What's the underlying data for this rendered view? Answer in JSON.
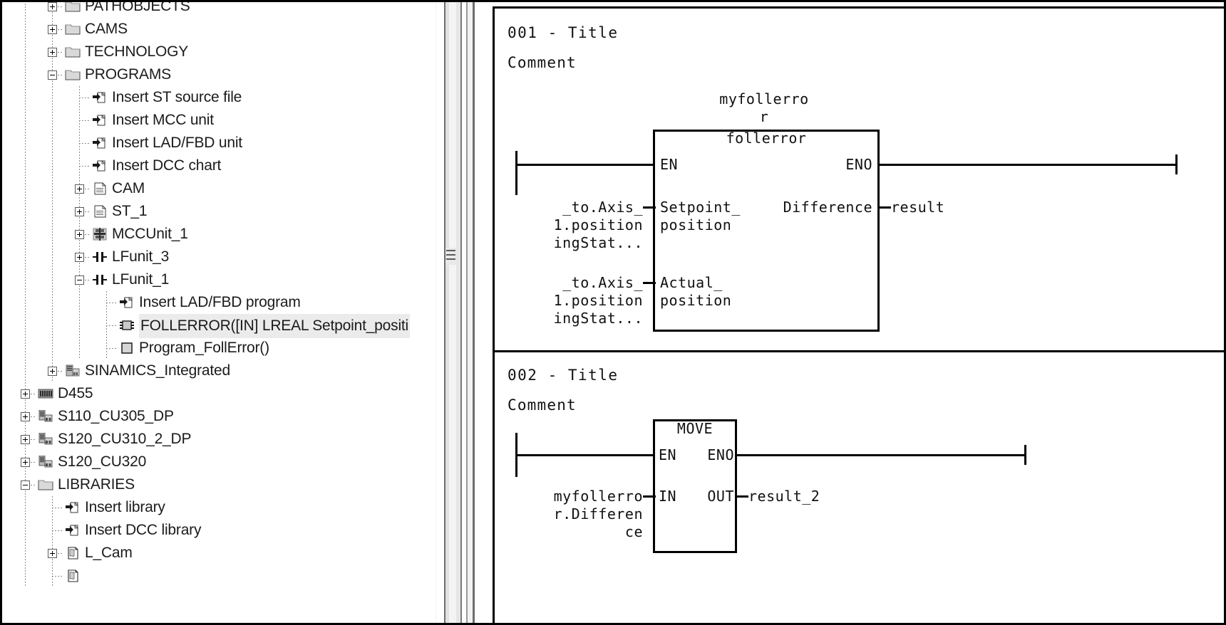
{
  "app": {
    "kind": "plc-engineering-fbd-editor"
  },
  "tree": {
    "name": "project-navigator",
    "items": [
      {
        "label": "PATHOBJECTS",
        "depth": 1,
        "expander": "plus",
        "icon": "folder-icon",
        "selected": false,
        "clipped_top": true
      },
      {
        "label": "CAMS",
        "depth": 1,
        "expander": "plus",
        "icon": "folder-icon",
        "selected": false
      },
      {
        "label": "TECHNOLOGY",
        "depth": 1,
        "expander": "plus",
        "icon": "folder-icon",
        "selected": false
      },
      {
        "label": "PROGRAMS",
        "depth": 1,
        "expander": "minus",
        "icon": "folder-icon",
        "selected": false
      },
      {
        "label": "Insert ST source file",
        "depth": 2,
        "expander": "none",
        "icon": "insert-arrow-icon",
        "selected": false
      },
      {
        "label": "Insert MCC unit",
        "depth": 2,
        "expander": "none",
        "icon": "insert-arrow-icon",
        "selected": false
      },
      {
        "label": "Insert LAD/FBD unit",
        "depth": 2,
        "expander": "none",
        "icon": "insert-arrow-icon",
        "selected": false
      },
      {
        "label": "Insert DCC chart",
        "depth": 2,
        "expander": "none",
        "icon": "insert-arrow-icon",
        "selected": false
      },
      {
        "label": "CAM",
        "depth": 2,
        "expander": "plus",
        "icon": "document-icon",
        "selected": false
      },
      {
        "label": "ST_1",
        "depth": 2,
        "expander": "plus",
        "icon": "document-icon",
        "selected": false
      },
      {
        "label": "MCCUnit_1",
        "depth": 2,
        "expander": "plus",
        "icon": "mcc-unit-icon",
        "selected": false
      },
      {
        "label": "LFunit_3",
        "depth": 2,
        "expander": "plus",
        "icon": "contact-icon",
        "selected": false
      },
      {
        "label": "LFunit_1",
        "depth": 2,
        "expander": "minus",
        "icon": "contact-icon",
        "selected": false
      },
      {
        "label": "Insert LAD/FBD program",
        "depth": 3,
        "expander": "none",
        "icon": "insert-arrow-icon",
        "selected": false
      },
      {
        "label": "FOLLERROR([IN] LREAL Setpoint_positi",
        "depth": 3,
        "expander": "none",
        "icon": "function-block-icon",
        "selected": true
      },
      {
        "label": "Program_FollError()",
        "depth": 3,
        "expander": "none",
        "icon": "program-icon",
        "selected": false
      },
      {
        "label": "SINAMICS_Integrated",
        "depth": 1,
        "expander": "plus",
        "icon": "drive-device-icon",
        "selected": false
      },
      {
        "label": "D455",
        "depth": 0,
        "expander": "plus",
        "icon": "controller-icon",
        "selected": false
      },
      {
        "label": "S110_CU305_DP",
        "depth": 0,
        "expander": "plus",
        "icon": "drive-unit-icon",
        "selected": false
      },
      {
        "label": "S120_CU310_2_DP",
        "depth": 0,
        "expander": "plus",
        "icon": "drive-unit-icon",
        "selected": false
      },
      {
        "label": "S120_CU320",
        "depth": 0,
        "expander": "plus",
        "icon": "drive-unit-icon",
        "selected": false
      },
      {
        "label": "LIBRARIES",
        "depth": 0,
        "expander": "minus",
        "icon": "folder-icon",
        "selected": false
      },
      {
        "label": "Insert library",
        "depth": 1,
        "expander": "none",
        "icon": "insert-arrow-icon",
        "selected": false
      },
      {
        "label": "Insert DCC library",
        "depth": 1,
        "expander": "none",
        "icon": "insert-arrow-icon",
        "selected": false
      },
      {
        "label": "L_Cam",
        "depth": 1,
        "expander": "plus",
        "icon": "library-doc-icon",
        "selected": false
      },
      {
        "label": "",
        "depth": 1,
        "expander": "none",
        "icon": "library-doc-icon",
        "selected": false,
        "clipped_bottom": true
      }
    ]
  },
  "splitter": {
    "name": "vertical-splitter",
    "grip": "grip-dots"
  },
  "fbd": {
    "networks": [
      {
        "title": "001 - Title",
        "comment": "Comment",
        "block": {
          "instance_name": "myfollerro\nr",
          "type_name": "follerror",
          "en_label": "EN",
          "eno_label": "ENO",
          "inputs": [
            {
              "pin": "Setpoint_\nposition",
              "operand": "_to.Axis_\n1.position\ningStat..."
            },
            {
              "pin": "Actual_\nposition",
              "operand": "_to.Axis_\n1.position\ningStat..."
            }
          ],
          "outputs": [
            {
              "pin": "Difference",
              "operand": "result"
            }
          ]
        }
      },
      {
        "title": "002 - Title",
        "comment": "Comment",
        "block": {
          "instance_name": "",
          "type_name": "MOVE",
          "en_label": "EN",
          "eno_label": "ENO",
          "inputs": [
            {
              "pin": "IN",
              "operand": "myfollerro\nr.Differen\nce"
            }
          ],
          "outputs": [
            {
              "pin": "OUT",
              "operand": "result_2"
            }
          ]
        }
      }
    ]
  },
  "colors": {
    "line": "#000000",
    "text": "#111111",
    "selection": "#ebebeb",
    "guide": "#8a8a8a",
    "splitter_dark": "#6e6e6e",
    "splitter_light": "#f4f4f4"
  }
}
